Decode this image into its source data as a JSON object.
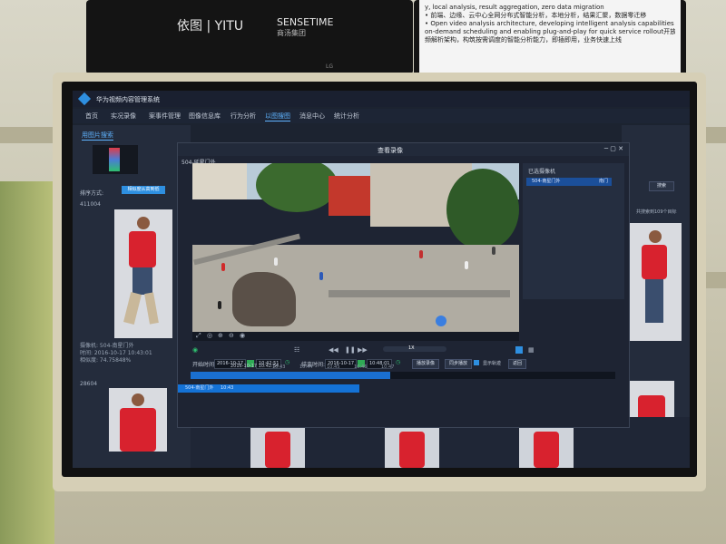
{
  "top_monitor": {
    "brand1": "依图 | YITU",
    "brand2": "SENSETIME",
    "brand2_sub": "商汤集团",
    "tv_brand": "LG"
  },
  "info_panel": {
    "lines": [
      "y, local analysis, result aggregation, zero data migration",
      "• 前端、边缘、云中心全网分布式智能分析，本地分析，结果汇聚，数据零迁移",
      "",
      "• Open video analysis architecture, developing intelligent analysis capabilities based on",
      "  on-demand scheduling and enabling plug-and-play for quick service rollout开放式视",
      "  频解析架构，构筑按需调度的智能分析能力，即插即用，业务快速上线"
    ]
  },
  "app": {
    "title": "华为视频内容管理系统",
    "nav": [
      "首页",
      "实况录像",
      "案事件管理",
      "图像信息库",
      "行为分析",
      "以图搜图",
      "消息中心",
      "统计分析"
    ],
    "nav_active_index": 5,
    "accent": "#2e8fe0"
  },
  "left_panel": {
    "subtab": "用图片搜索",
    "sort_label": "排序方式:",
    "sort_value": "相似度从高到低",
    "result1": {
      "id": "411004",
      "meta1": "摄像机: 504-南星门外",
      "meta2": "时间: 2016-10-17 10:43:01",
      "meta3": "相似度: 74.75848%"
    },
    "result2_id": "28604"
  },
  "modal": {
    "title": "查看录像",
    "camera": "504-延星门外",
    "window_buttons": "─ ▢ ✕",
    "start_label": "开始时间:",
    "start_date": "2016-10-17",
    "start_time": "10:42:51",
    "end_label": "结束时间:",
    "end_date": "2016-10-17",
    "end_time": "10:48:01",
    "play_button": "播放录像",
    "sync_button": "同步播放",
    "show_track_label": "显示轨迹",
    "show_track_checked": true,
    "return_button": "返回",
    "speed": "1X",
    "timeline_current": "2016-10-17 10:42:54",
    "timeline_ticks": [
      "10:43",
      "10:44",
      "10:45",
      "10:46",
      "10:47"
    ],
    "playback_fraction": 0.47,
    "progress_label": "504-南星门外",
    "progress_time": "10:43"
  },
  "right_list": {
    "title": "已选摄像机",
    "item": "504-南星门外",
    "item_tag": "南门"
  },
  "right_column": {
    "button": "搜索",
    "label": "共搜索到109个目标"
  }
}
